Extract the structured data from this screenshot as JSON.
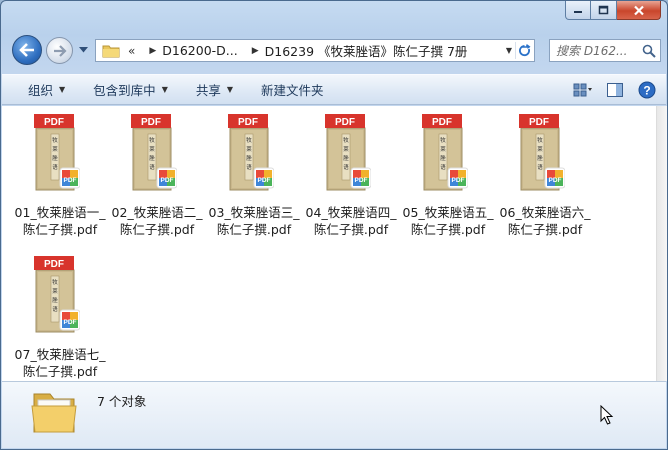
{
  "window": {
    "caption": {
      "minimize": "minimize",
      "maximize": "maximize",
      "close": "close"
    }
  },
  "address": {
    "chevron": "«",
    "segments": [
      "D16200-D...",
      "D16239 《牧莱脞语》陈仁子撰 7册"
    ]
  },
  "search": {
    "placeholder": "搜索 D162..."
  },
  "toolbar": {
    "organize": "组织",
    "include_library": "包含到库中",
    "share": "共享",
    "new_folder": "新建文件夹"
  },
  "files": [
    {
      "label": "01_牧莱脞语一_\n陈仁子撰.pdf",
      "badge": "PDF"
    },
    {
      "label": "02_牧莱脞语二_\n陈仁子撰.pdf",
      "badge": "PDF"
    },
    {
      "label": "03_牧莱脞语三_\n陈仁子撰.pdf",
      "badge": "PDF"
    },
    {
      "label": "04_牧莱脞语四_\n陈仁子撰.pdf",
      "badge": "PDF"
    },
    {
      "label": "05_牧莱脞语五_\n陈仁子撰.pdf",
      "badge": "PDF"
    },
    {
      "label": "06_牧莱脞语六_\n陈仁子撰.pdf",
      "badge": "PDF"
    },
    {
      "label": "07_牧莱脞语七_\n陈仁子撰.pdf",
      "badge": "PDF"
    }
  ],
  "status": {
    "count_text": "7 个对象"
  },
  "colors": {
    "pdf_red": "#d8342c",
    "book_cover": "#c8b68a",
    "accent": "#2f6fc0"
  }
}
